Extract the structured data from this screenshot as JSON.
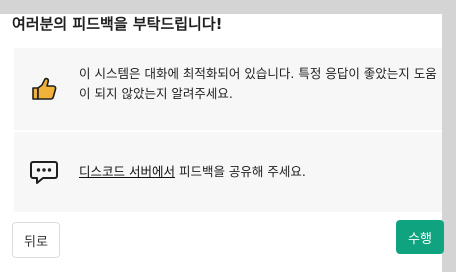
{
  "dialog": {
    "title": "여러분의 피드백을 부탁드립니다!",
    "cards": [
      {
        "icon": "thumbs-up-icon",
        "text": "이 시스템은 대화에 최적화되어 있습니다. 특정 응답이 좋았는지 도움이 되지 않았는지 알려주세요."
      },
      {
        "icon": "chat-bubble-icon",
        "link_text": "디스코드 서버에서",
        "text": " 피드백을 공유해 주세요."
      }
    ],
    "back_label": "뒤로",
    "done_label": "수행"
  },
  "colors": {
    "accent": "#10a37f",
    "card_bg": "#f7f7f8",
    "thumb": "#f2b23a"
  }
}
